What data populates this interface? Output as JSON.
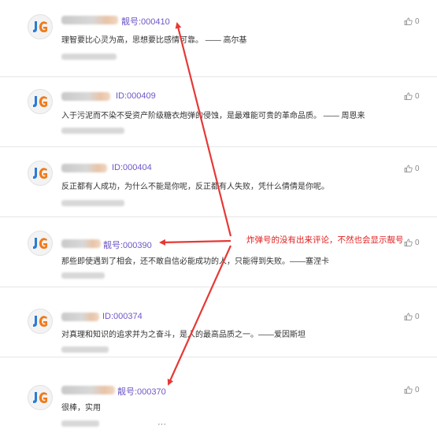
{
  "comments": [
    {
      "id": "靓号:000410",
      "content": "理智要比心灵为高，思想要比感情可靠。 —— 高尔基",
      "likes": "0"
    },
    {
      "id": "ID:000409",
      "content": "入于污泥而不染不受资产阶级糖衣炮弹的侵蚀，是最难能可贵的革命品质。 —— 周恩来",
      "likes": "0"
    },
    {
      "id": "ID:000404",
      "content": "反正都有人成功，为什么不能是你呢，反正都有人失败，凭什么倩倩是你呢。",
      "likes": "0"
    },
    {
      "id": "靓号:000390",
      "content": "那些即使遇到了相会，还不敢自信必能成功的人，只能得到失败。——塞涅卡",
      "likes": "0"
    },
    {
      "id": "ID:000374",
      "content": "对真理和知识的追求并为之奋斗，是人的最高品质之一。——爱因斯坦",
      "likes": "0"
    },
    {
      "id": "靓号:000370",
      "content": "很棒，实用",
      "likes": "0"
    }
  ],
  "annotation": "炸弹号的没有出来评论，不然也会显示靓号",
  "more_indicator": "···",
  "colors": {
    "id_tag": "#6f56c7",
    "annotation": "#e02020",
    "arrow": "#e53935"
  },
  "icons": {
    "like": "thumbs-up-icon",
    "avatar": "site-logo-icon"
  }
}
